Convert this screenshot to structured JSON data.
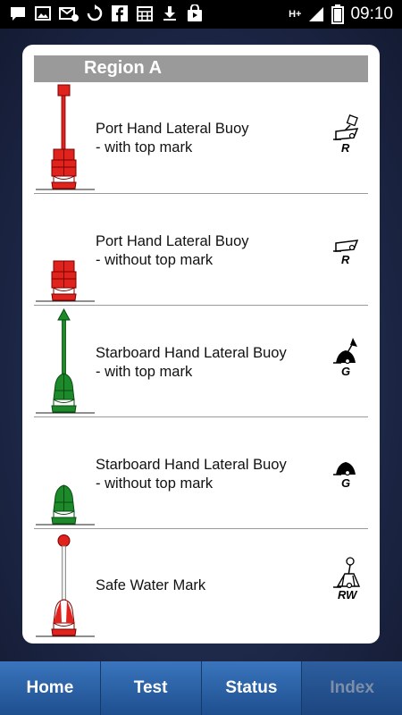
{
  "status_bar": {
    "network": "H+",
    "time": "09:10",
    "icons": [
      "chat-icon",
      "image-icon",
      "email-icon",
      "sync-icon",
      "facebook-icon",
      "calendar-icon",
      "download-icon",
      "shopping-bag-icon",
      "signal-icon",
      "battery-icon"
    ]
  },
  "card": {
    "title": "Region A",
    "items": [
      {
        "line1": "Port Hand Lateral Buoy",
        "line2": "- with top mark",
        "chart_label": "R",
        "color": "#e0231c",
        "top_mark": "square"
      },
      {
        "line1": "Port Hand Lateral Buoy",
        "line2": "- without top mark",
        "chart_label": "R",
        "color": "#e0231c",
        "top_mark": "none"
      },
      {
        "line1": "Starboard Hand Lateral Buoy",
        "line2": "- with top mark",
        "chart_label": "G",
        "color": "#1c8a2a",
        "top_mark": "triangle"
      },
      {
        "line1": "Starboard Hand Lateral Buoy",
        "line2": "- without top mark",
        "chart_label": "G",
        "color": "#1c8a2a",
        "top_mark": "none"
      },
      {
        "line1": "Safe Water Mark",
        "line2": "",
        "chart_label": "RW",
        "color": "#e0231c",
        "top_mark": "sphere"
      }
    ]
  },
  "nav": {
    "tabs": [
      {
        "label": "Home"
      },
      {
        "label": "Test"
      },
      {
        "label": "Status"
      },
      {
        "label": "Index"
      }
    ],
    "active": "Index"
  }
}
